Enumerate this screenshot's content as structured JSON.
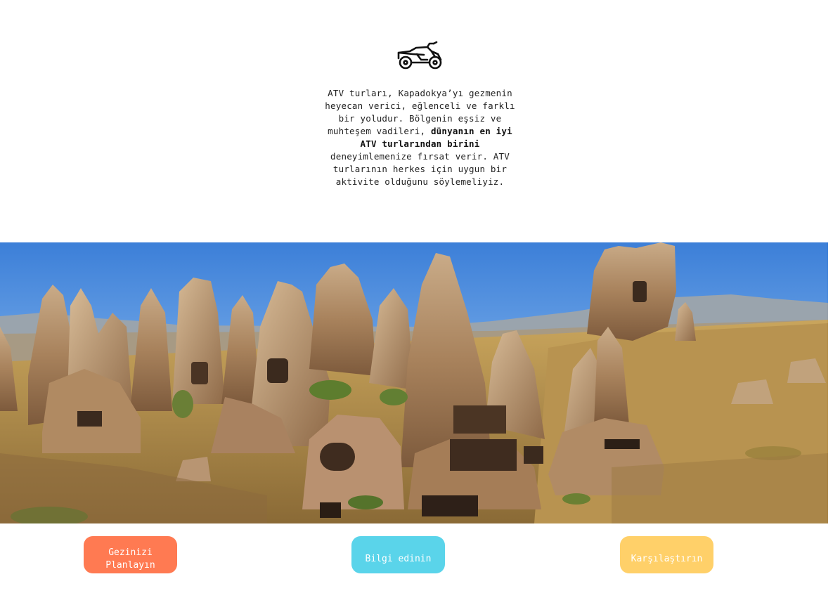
{
  "intro": {
    "icon": "atv-icon",
    "text_part1": "ATV turları, Kapadokya’yı gezmenin heyecan verici, eğlenceli ve farklı bir yoludur. Bölgenin eşsiz ve muhteşem vadileri, ",
    "text_bold": "dünyanın en iyi ATV turlarından birini",
    "text_part2": " deneyimlemenize fırsat verir. ATV turlarının herkes için uygun bir aktivite olduğunu söylemeliyiz."
  },
  "hero": {
    "image": "cappadocia-fairy-chimneys-photo"
  },
  "buttons": {
    "plan_label": "Gezinizi Planlayın",
    "info_label": "Bilgi edinin",
    "compare_label": "Karşılaştırın"
  },
  "colors": {
    "plan": "#ff7a52",
    "info": "#5ad4ea",
    "compare": "#ffd069"
  }
}
